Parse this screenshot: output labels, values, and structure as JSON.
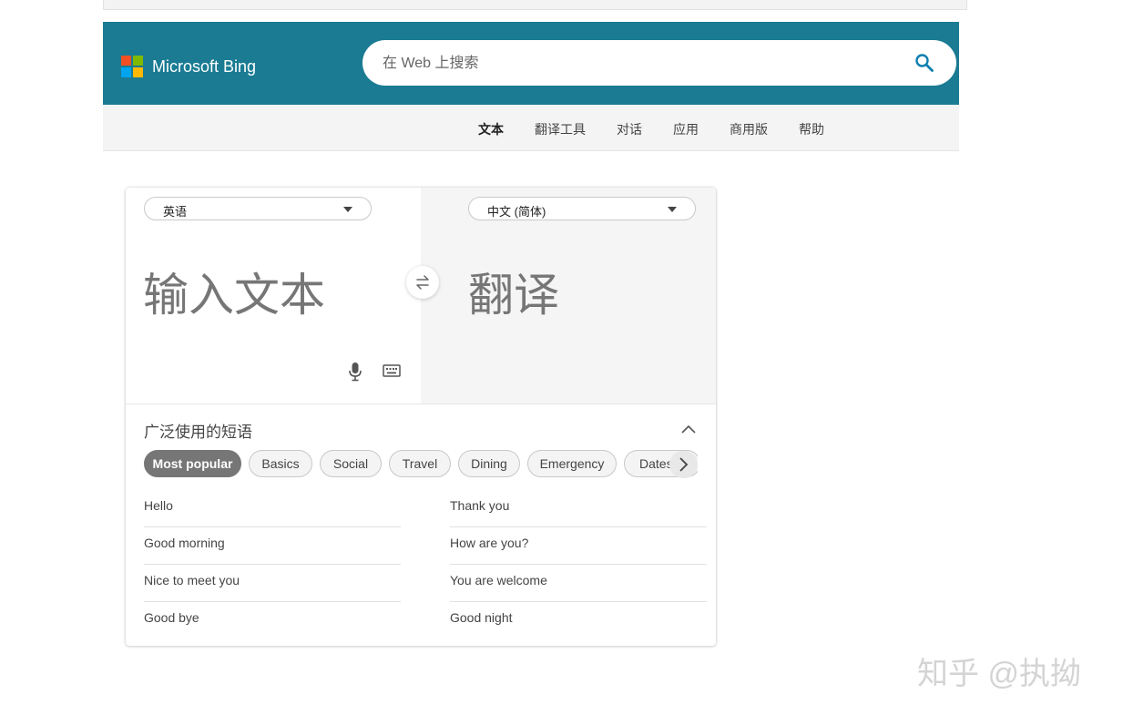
{
  "header": {
    "brand": "Microsoft Bing",
    "search_placeholder": "在 Web 上搜索"
  },
  "nav": {
    "items": [
      {
        "label": "文本",
        "active": true
      },
      {
        "label": "翻译工具",
        "active": false
      },
      {
        "label": "对话",
        "active": false
      },
      {
        "label": "应用",
        "active": false
      },
      {
        "label": "商用版",
        "active": false
      },
      {
        "label": "帮助",
        "active": false
      }
    ]
  },
  "translator": {
    "source_lang": "英语",
    "target_lang": "中文 (简体)",
    "input_placeholder": "输入文本",
    "output_placeholder": "翻译"
  },
  "phrases": {
    "title": "广泛使用的短语",
    "categories": [
      "Most popular",
      "Basics",
      "Social",
      "Travel",
      "Dining",
      "Emergency",
      "Dates"
    ],
    "active_category": "Most popular",
    "left": [
      "Hello",
      "Good morning",
      "Nice to meet you",
      "Good bye"
    ],
    "right": [
      "Thank you",
      "How are you?",
      "You are welcome",
      "Good night"
    ]
  },
  "watermark": "知乎 @执拗",
  "colors": {
    "header_bg": "#1a7b93",
    "accent": "#0e7fae",
    "chip_active": "#767676",
    "ms_red": "#f25022",
    "ms_green": "#7fba00",
    "ms_blue": "#00a4ef",
    "ms_yellow": "#ffb900"
  }
}
